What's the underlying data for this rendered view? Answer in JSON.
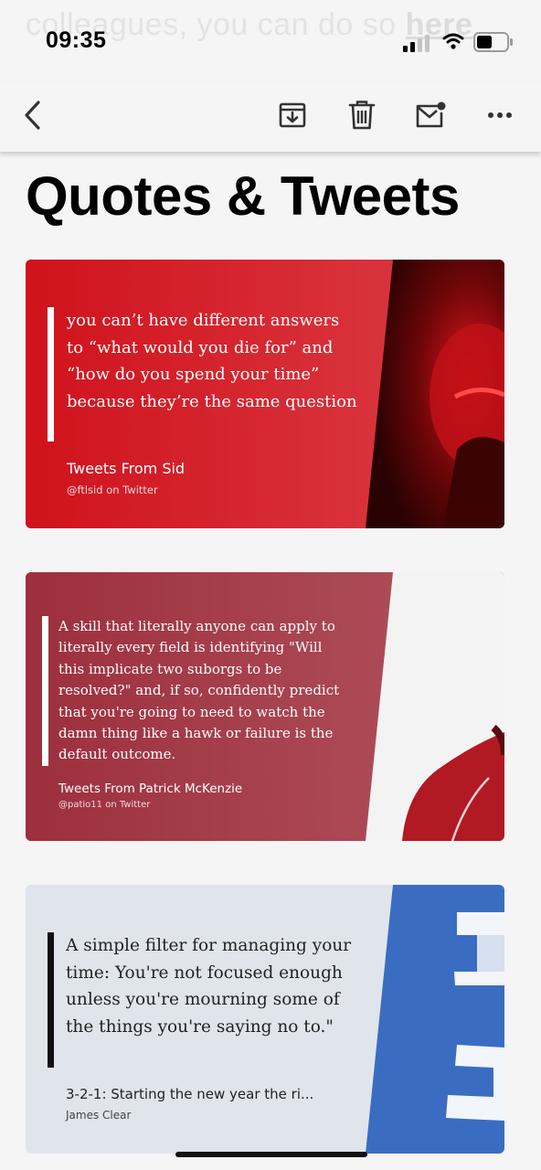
{
  "background_text": {
    "before": "colleagues, you can do so ",
    "link": "here"
  },
  "status": {
    "time": "09:35"
  },
  "toolbar": {
    "back": "chevron-left-icon",
    "archive": "archive-icon",
    "delete": "trash-icon",
    "mark_unread": "mail-unread-icon",
    "more": "more-icon"
  },
  "page": {
    "title": "Quotes & Tweets"
  },
  "cards": [
    {
      "quote": "you can’t have different answers to “what would you die for” and “how do you spend your time” because they’re the same question",
      "source": "Tweets From Sid",
      "sub": "@ftlsid on Twitter",
      "color": "#d41c24"
    },
    {
      "quote": "A skill that literally anyone can apply to literally every field is identifying \"Will this implicate two suborgs to be resolved?\" and, if so, confidently predict that you're going to need to watch the damn thing like a hawk or failure is the default outcome.",
      "source": "Tweets From Patrick McKenzie",
      "sub": "@patio11 on Twitter",
      "color": "#a83f4b"
    },
    {
      "quote": "A simple filter for managing your time: You're not focused enough unless you're mourning some of the things you're saying no to.\"",
      "source": "3-2-1: Starting the new year the ri...",
      "sub": "James Clear",
      "color": "#e0e5ec"
    }
  ]
}
